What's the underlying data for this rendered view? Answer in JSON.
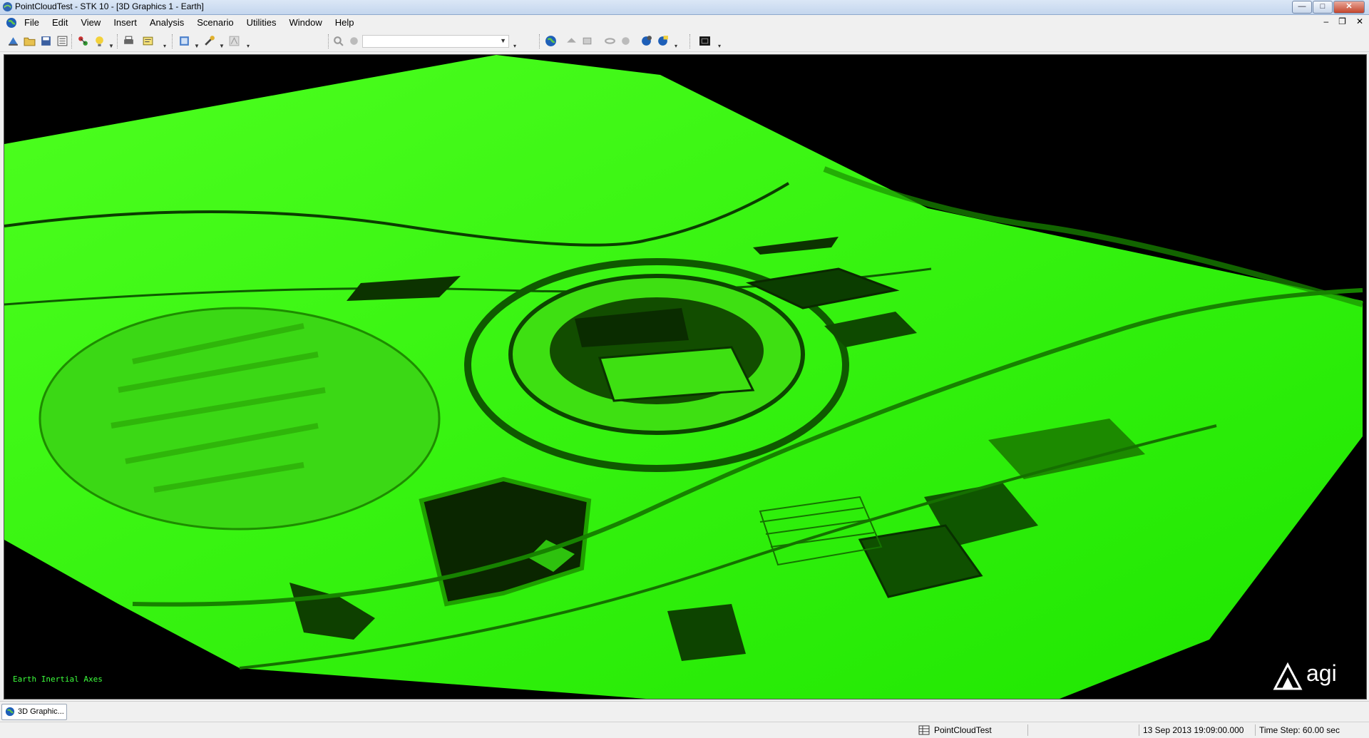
{
  "window": {
    "title": "PointCloudTest - STK 10 - [3D Graphics 1 - Earth]",
    "controls": {
      "minimize": "—",
      "maximize": "□",
      "close": "✕"
    }
  },
  "menubar": {
    "items": [
      "File",
      "Edit",
      "View",
      "Insert",
      "Analysis",
      "Scenario",
      "Utilities",
      "Window",
      "Help"
    ],
    "mdi_controls": {
      "minimize": "–",
      "restore": "❐",
      "close": "✕"
    }
  },
  "toolbar": {
    "combo_value": ""
  },
  "viewport": {
    "axes_label": "Earth Inertial Axes",
    "logo_text": "agi",
    "point_cloud_color": "#22ff00"
  },
  "tabs": [
    {
      "label": "3D Graphic..."
    }
  ],
  "status": {
    "scenario": "PointCloudTest",
    "datetime": "13 Sep 2013 19:09:00.000",
    "time_step": "Time Step: 60.00 sec"
  }
}
